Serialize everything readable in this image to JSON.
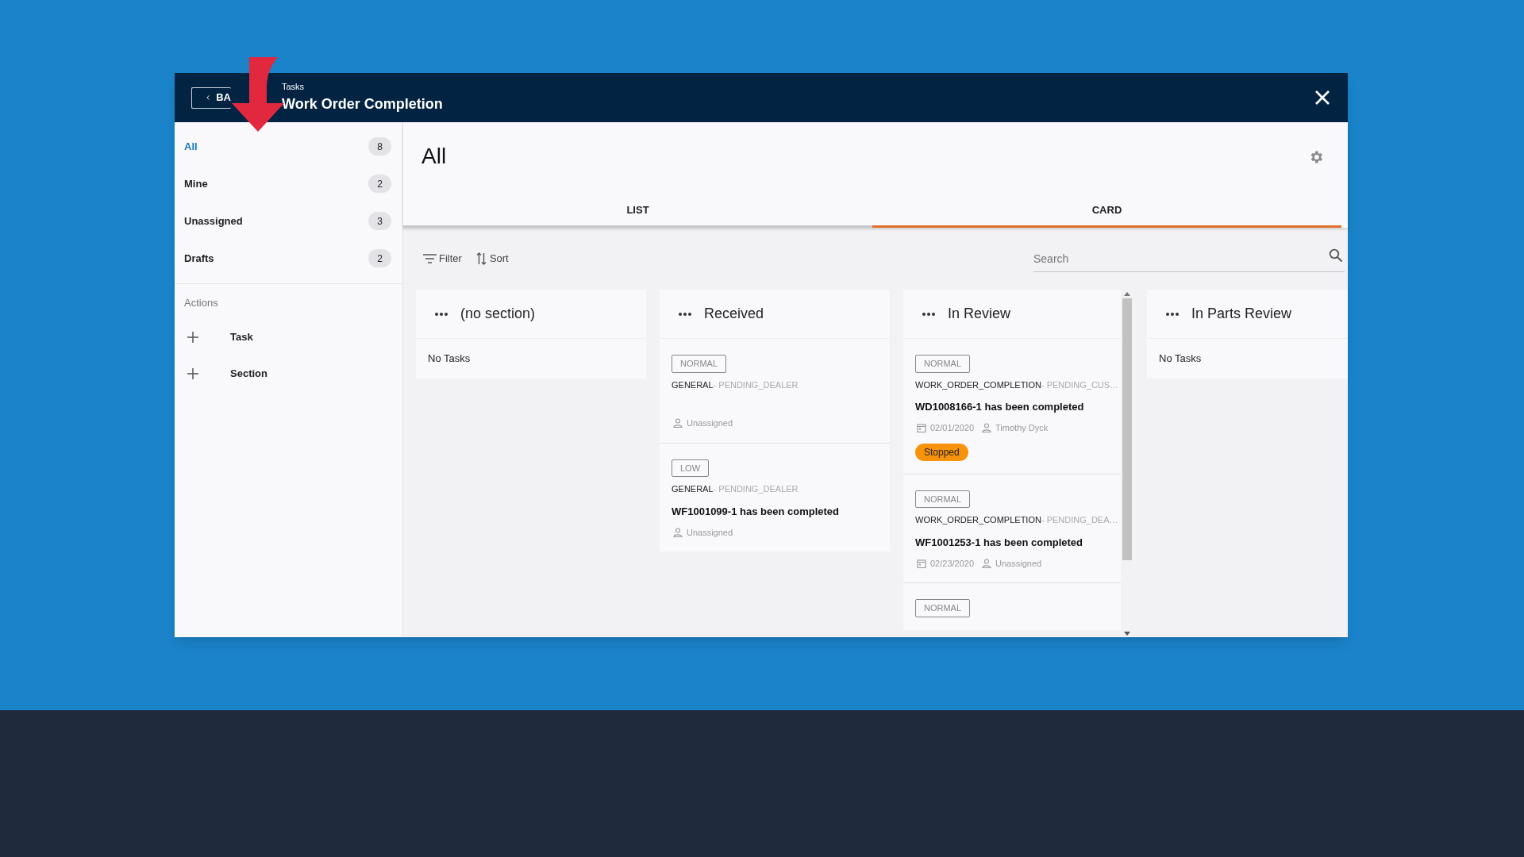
{
  "window": {
    "back_button": "BA",
    "breadcrumb": "Tasks",
    "title": "Work Order Completion"
  },
  "sidebar": {
    "items": [
      {
        "label": "All",
        "count": "8",
        "selected": true
      },
      {
        "label": "Mine",
        "count": "2",
        "selected": false
      },
      {
        "label": "Unassigned",
        "count": "3",
        "selected": false
      },
      {
        "label": "Drafts",
        "count": "2",
        "selected": false
      }
    ],
    "actions_heading": "Actions",
    "actions": [
      {
        "label": "Task"
      },
      {
        "label": "Section"
      }
    ]
  },
  "main": {
    "heading": "All",
    "tabs": [
      {
        "label": "LIST",
        "selected": false
      },
      {
        "label": "CARD",
        "selected": true
      }
    ],
    "toolbar": {
      "filter": "Filter",
      "sort": "Sort"
    },
    "search": {
      "placeholder": "Search"
    }
  },
  "columns": [
    {
      "title": "(no section)",
      "empty_text": "No Tasks",
      "scrollbar": false
    },
    {
      "title": "Received",
      "scrollbar": false,
      "cards": [
        {
          "priority": "NORMAL",
          "category": "GENERAL",
          "status": "- PENDING_DEALER",
          "assignee": "Unassigned"
        },
        {
          "priority": "LOW",
          "category": "GENERAL",
          "status": "- PENDING_DEALER",
          "title": "WF1001099-1 has been completed",
          "assignee": "Unassigned"
        }
      ]
    },
    {
      "title": "In Review",
      "scrollbar": true,
      "cards": [
        {
          "priority": "NORMAL",
          "category": "WORK_ORDER_COMPLETION",
          "status": "- PENDING_CUS…",
          "title": "WD1008166-1 has been completed",
          "date": "02/01/2020",
          "assignee": "Timothy Dyck",
          "badge": "Stopped"
        },
        {
          "priority": "NORMAL",
          "category": "WORK_ORDER_COMPLETION",
          "status": "- PENDING_DEA…",
          "title": "WF1001253-1 has been completed",
          "date": "02/23/2020",
          "assignee": "Unassigned"
        },
        {
          "priority": "NORMAL"
        }
      ]
    },
    {
      "title": "In Parts Review",
      "empty_text": "No Tasks",
      "scrollbar": false
    }
  ]
}
